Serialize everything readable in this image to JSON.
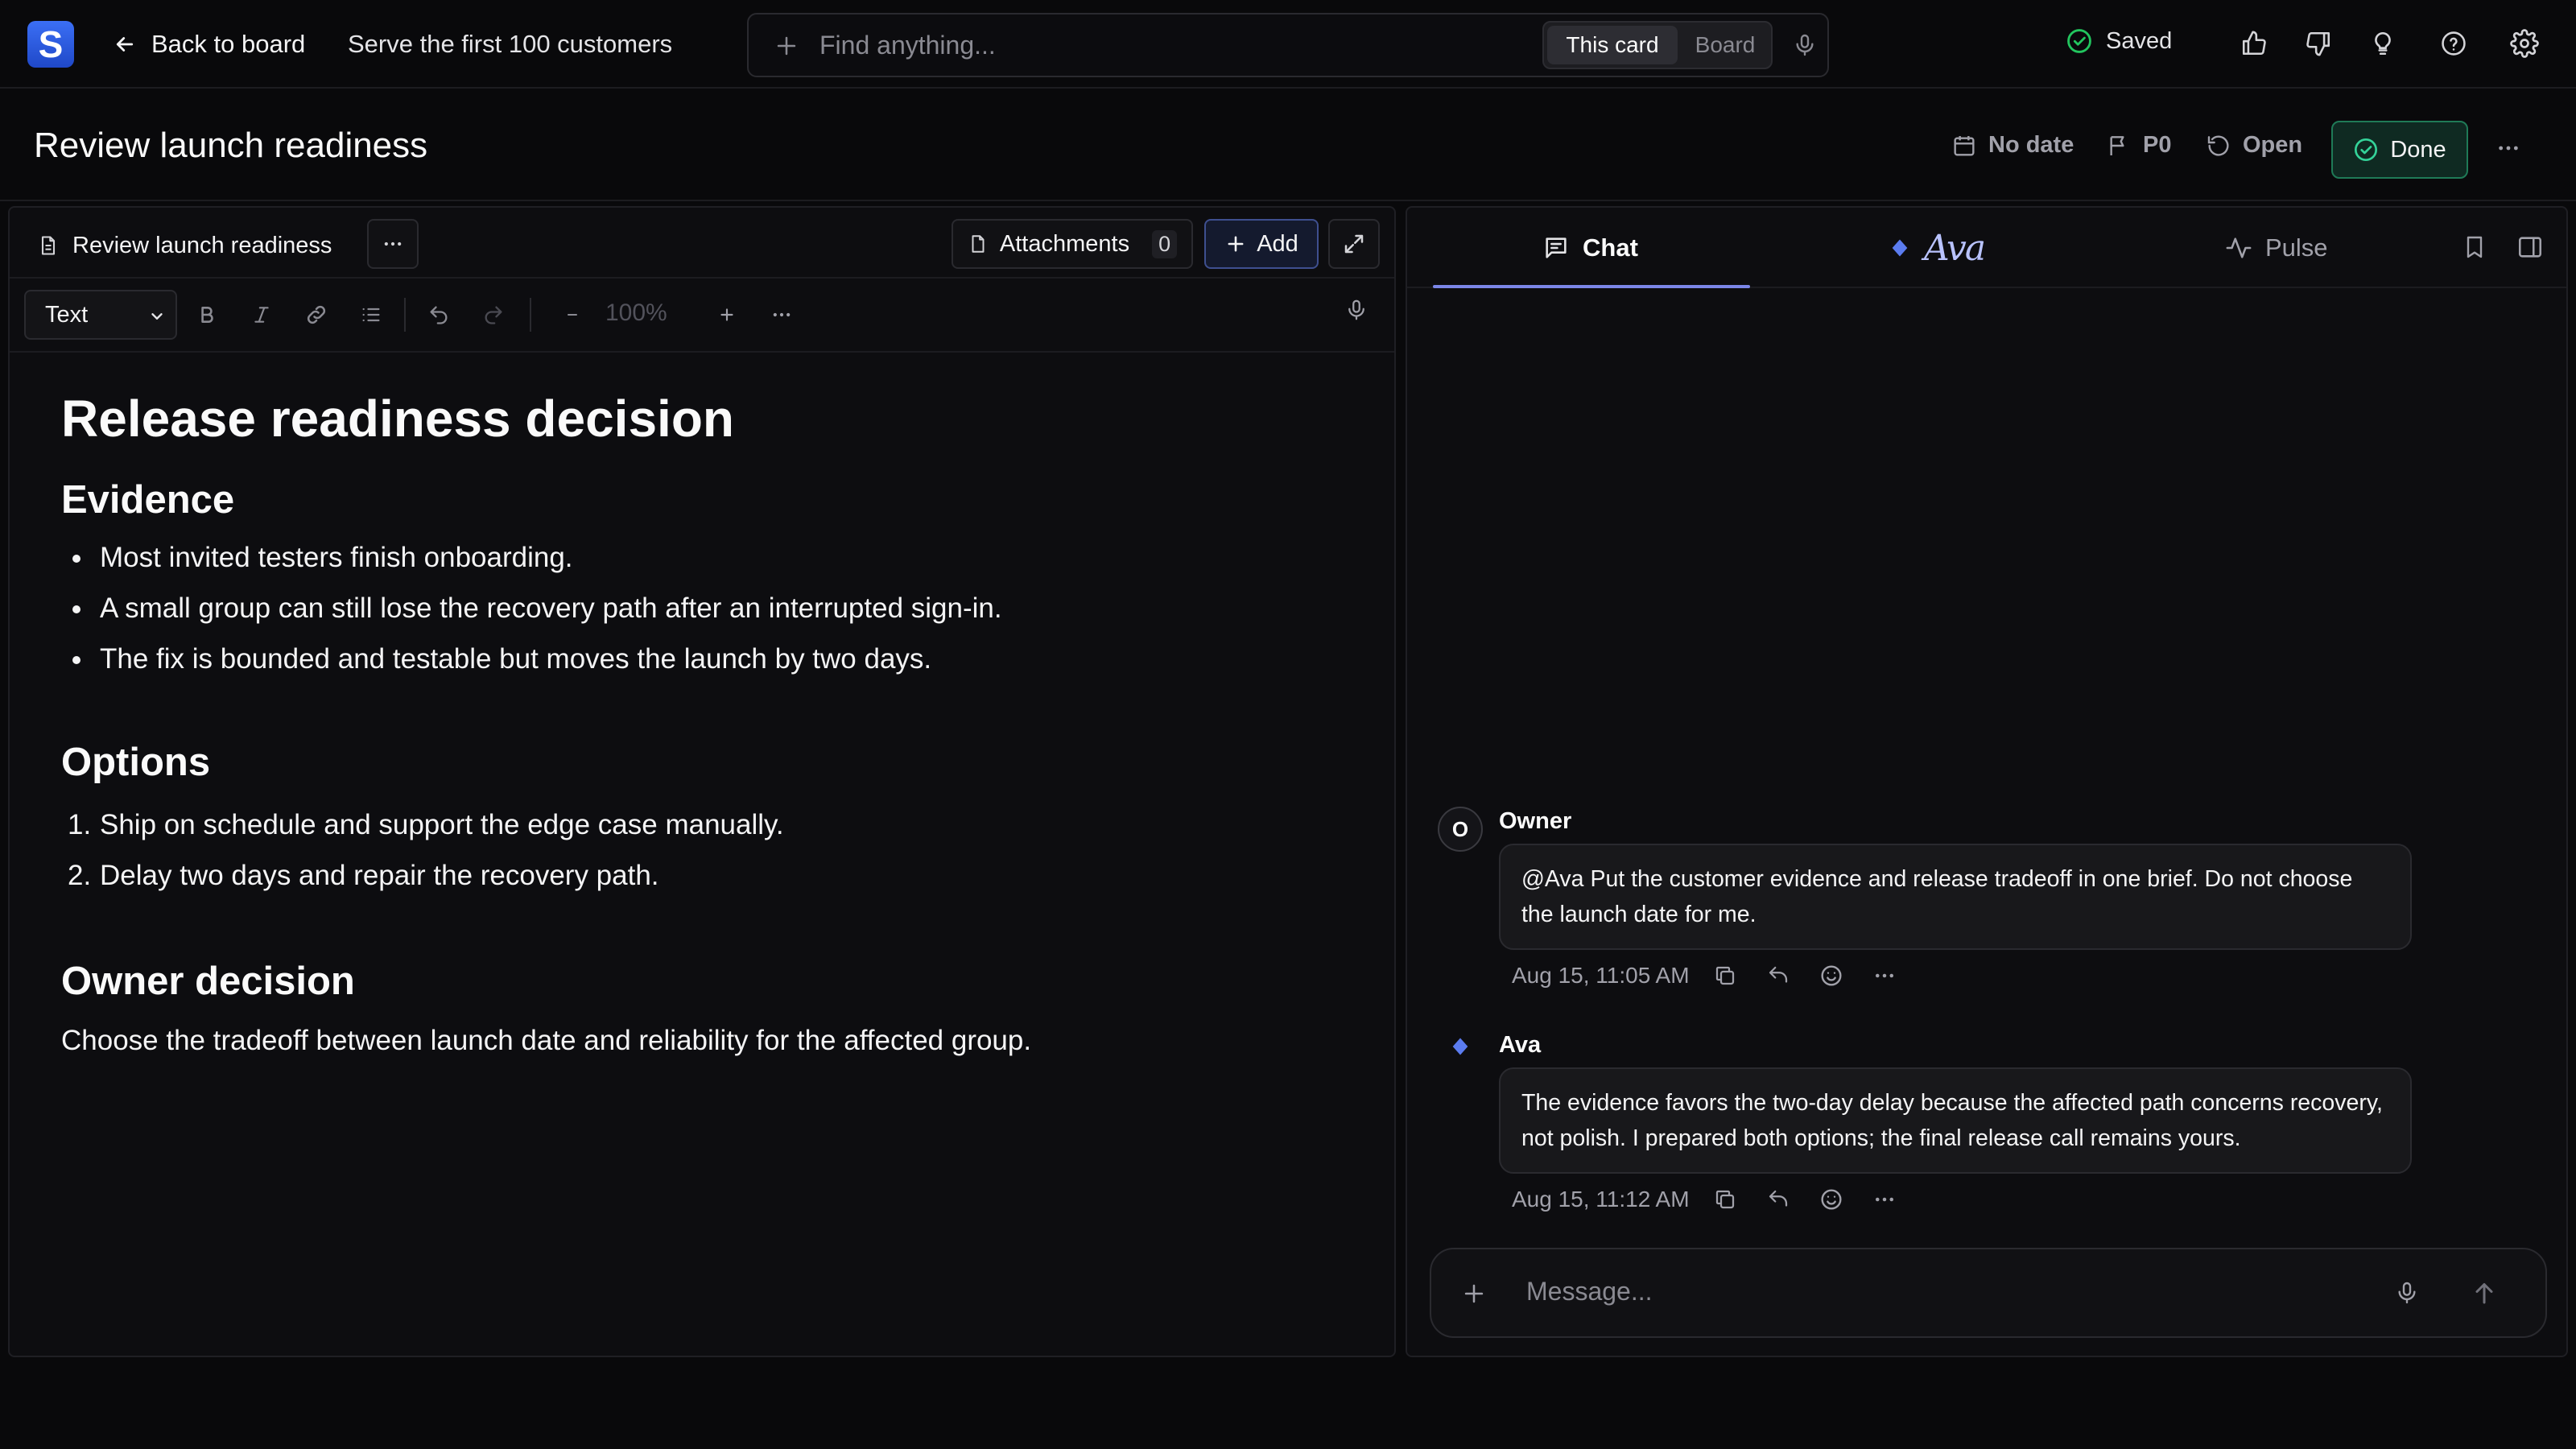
{
  "app": {
    "logo_letter": "S"
  },
  "topbar": {
    "back_label": "Back to board",
    "board_title": "Serve the first 100 customers",
    "search_placeholder": "Find anything...",
    "scope_options": [
      "This card",
      "Board"
    ],
    "scope_selected": "This card",
    "save_status": "Saved"
  },
  "card": {
    "title": "Review launch readiness",
    "date": "No date",
    "priority": "P0",
    "status": "Open",
    "done_label": "Done"
  },
  "editor": {
    "doc_tab": "Review launch readiness",
    "attachments_label": "Attachments",
    "attachments_count": "0",
    "add_label": "Add",
    "block_type": "Text",
    "zoom": "100%",
    "doc": {
      "title": "Release readiness decision",
      "evidence_heading": "Evidence",
      "evidence": [
        "Most invited testers finish onboarding.",
        "A small group can still lose the recovery path after an interrupted sign-in.",
        "The fix is bounded and testable but moves the launch by two days."
      ],
      "options_heading": "Options",
      "options": [
        "Ship on schedule and support the edge case manually.",
        "Delay two days and repair the recovery path."
      ],
      "decision_heading": "Owner decision",
      "decision_text": "Choose the tradeoff between launch date and reliability for the affected group."
    }
  },
  "chat": {
    "tabs": [
      "Chat",
      "Ava",
      "Pulse"
    ],
    "active_tab": "Chat",
    "messages": [
      {
        "avatar": "O",
        "sender": "Owner",
        "text": "@Ava Put the customer evidence and release tradeoff in one brief. Do not choose the launch date for me.",
        "time": "Aug 15, 11:05 AM"
      },
      {
        "avatar": "ava-diamond-icon",
        "sender": "Ava",
        "text": "The evidence favors the two-day delay because the affected path concerns recovery, not polish. I prepared both options; the final release call remains yours.",
        "time": "Aug 15, 11:12 AM"
      }
    ],
    "composer_placeholder": "Message..."
  },
  "colors": {
    "background": "#09090b",
    "panel": "#0d0d10",
    "accent": "#7b86e8",
    "done_border": "#1f7a57",
    "saved_green": "#22c55e",
    "logo_blue": "#2f5ee6"
  }
}
